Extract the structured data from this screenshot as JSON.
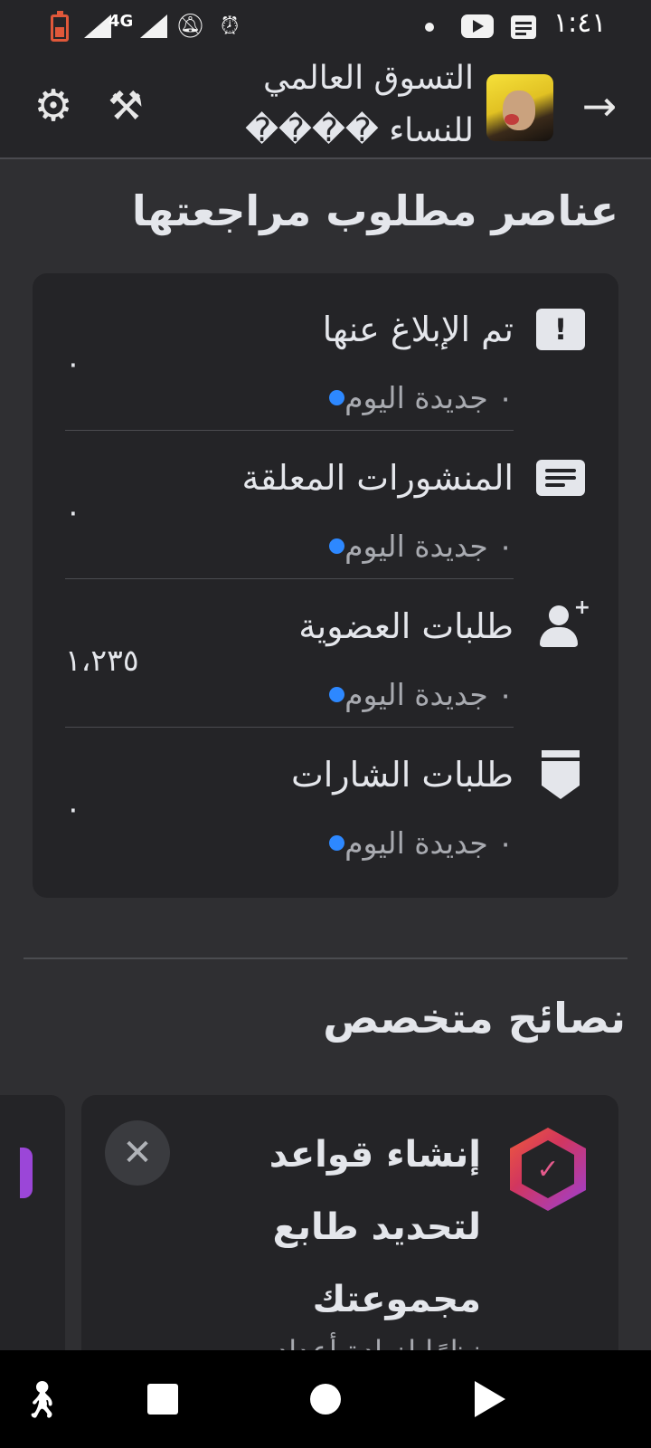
{
  "status_bar": {
    "network": "4G",
    "time": "١:٤١",
    "icons": [
      "battery-low-icon",
      "signal-icon",
      "signal-icon",
      "bell-off-icon",
      "alarm-icon",
      "dot-icon",
      "youtube-icon",
      "message-icon"
    ]
  },
  "header": {
    "title_line1": "التسوق العالمي",
    "title_line2": "للنساء ����",
    "icons": [
      "arrow-right-icon",
      "group-avatar",
      "tools-icon",
      "gear-icon"
    ]
  },
  "review": {
    "title": "عناصر مطلوب مراجعتها",
    "items": [
      {
        "label": "تم الإبلاغ عنها",
        "sub": "٠ جديدة اليوم",
        "count": "٠",
        "icon": "report-icon"
      },
      {
        "label": "المنشورات المعلقة",
        "sub": "٠ جديدة اليوم",
        "count": "٠",
        "icon": "pending-posts-icon"
      },
      {
        "label": "طلبات العضوية",
        "sub": "٠ جديدة اليوم",
        "count": "١،٢٣٥",
        "icon": "add-person-icon"
      },
      {
        "label": "طلبات الشارات",
        "sub": "٠ جديدة اليوم",
        "count": "٠",
        "icon": "badge-icon"
      }
    ]
  },
  "tips": {
    "title": "نصائح متخصص",
    "card": {
      "title": "إنشاء قواعد لتحديد طابع مجموعتك",
      "sub": "نظرًا لزيادة أعداد",
      "close": "✕",
      "icon": "shield-check-icon"
    }
  },
  "nav_bar": {
    "icons": [
      "accessibility-icon",
      "recents-icon",
      "home-icon",
      "back-icon"
    ]
  },
  "colors": {
    "background": "#2f2f32",
    "card": "#242427",
    "accent_dot": "#2d88ff",
    "text_primary": "#e4e6eb",
    "text_secondary": "#a8aab0"
  }
}
